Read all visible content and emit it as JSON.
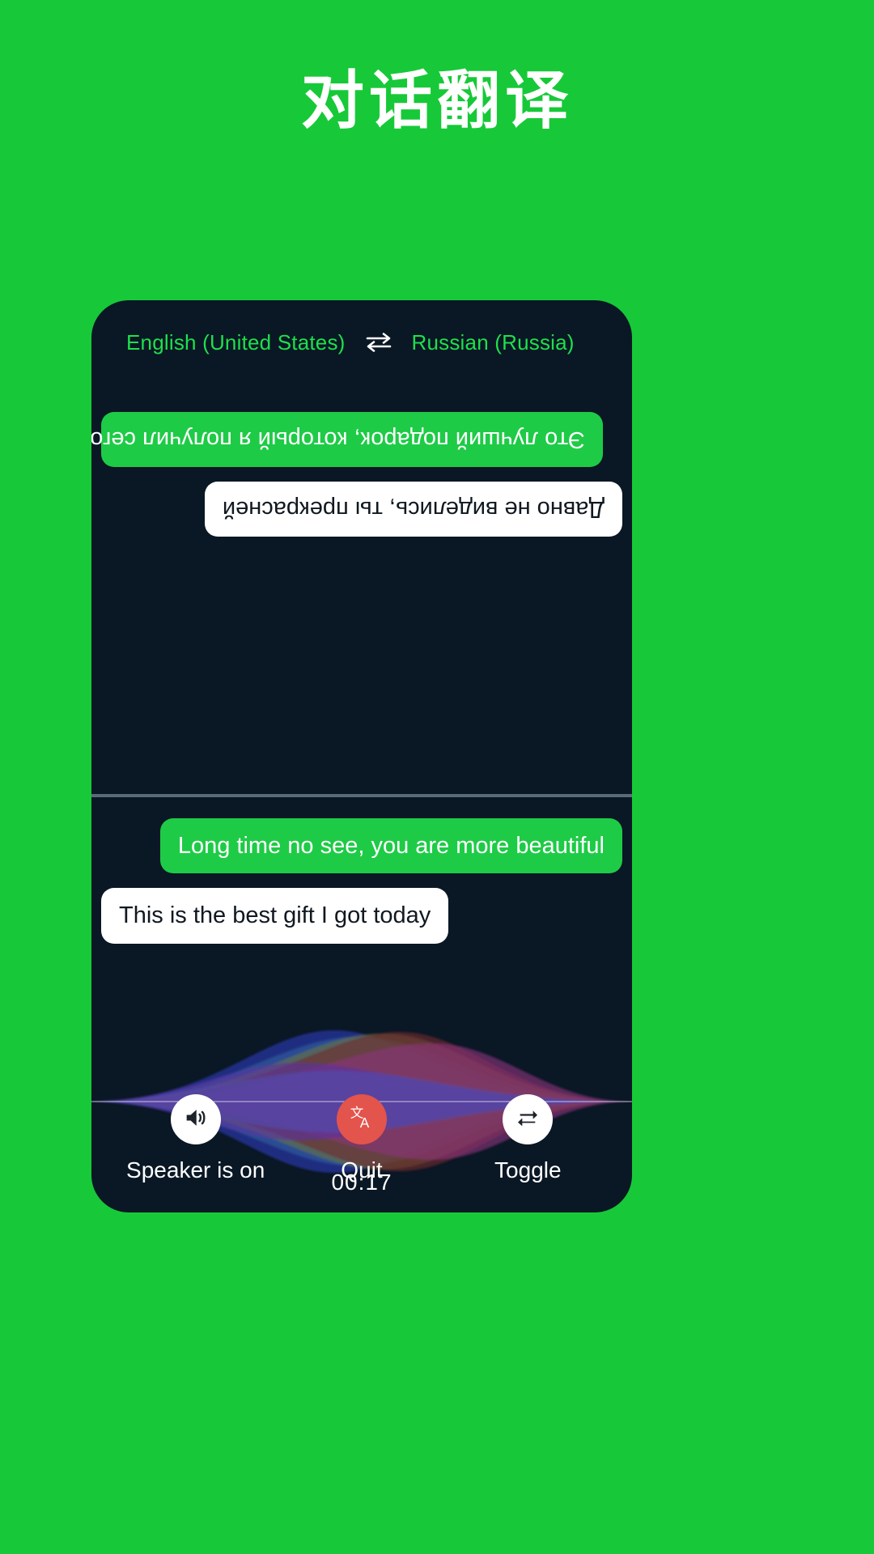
{
  "header": {
    "title": "对话翻译"
  },
  "colors": {
    "background_green": "#17c938",
    "panel_dark": "#0a1725",
    "accent_green": "#1ecb46",
    "lang_text_green": "#1ee04a",
    "quit_red": "#e2544c",
    "bubble_white": "#ffffff",
    "divider_gray": "#5a6a78"
  },
  "language_bar": {
    "source_language": "English (United States)",
    "swap_icon": "swap-horizontal-arrows-icon",
    "target_language": "Russian (Russia)"
  },
  "conversation": {
    "top_pane": {
      "orientation": "rotated-180",
      "language": "Russian (Russia)",
      "messages": [
        {
          "id": "ru-1",
          "text": "Давно не виделись, ты прекрасней",
          "style": "white",
          "align": "left"
        },
        {
          "id": "ru-2",
          "text": "Это лучший подарок, который я получил сегодня",
          "style": "green",
          "align": "right"
        }
      ]
    },
    "bottom_pane": {
      "orientation": "normal",
      "language": "English (United States)",
      "messages": [
        {
          "id": "en-1",
          "text": "Long time no see, you are more beautiful",
          "style": "green",
          "align": "right"
        },
        {
          "id": "en-2",
          "text": "This is the best gift I got today",
          "style": "white",
          "align": "left"
        }
      ]
    }
  },
  "waveform": {
    "label": "audio-waveform-visualizer",
    "colors": [
      "#7a3fd0",
      "#2f3fc4",
      "#3f7fd0",
      "#8f9a4a",
      "#9a3030",
      "#c03fa0",
      "#6a5fe0"
    ]
  },
  "timer": {
    "elapsed": "00:17"
  },
  "controls": [
    {
      "id": "speaker",
      "icon": "speaker-on-icon",
      "label": "Speaker is on",
      "circle_style": "light"
    },
    {
      "id": "quit",
      "icon": "translate-icon",
      "label": "Quit",
      "circle_style": "danger"
    },
    {
      "id": "toggle",
      "icon": "repeat-swap-icon",
      "label": "Toggle",
      "circle_style": "light"
    }
  ]
}
